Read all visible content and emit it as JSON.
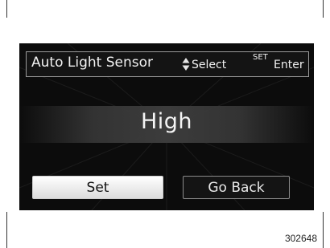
{
  "header": {
    "title": "Auto Light Sensor",
    "select_hint": "Select",
    "set_hint": "SET",
    "enter_hint": "Enter",
    "select_icon": "up-down-arrows-icon"
  },
  "main": {
    "value": "High"
  },
  "buttons": {
    "set_label": "Set",
    "back_label": "Go Back"
  },
  "figure": {
    "id": "302648"
  },
  "colors": {
    "screen_bg": "#0c0c0c",
    "text": "#f2f2f2",
    "selected_button": "#ffffff"
  }
}
